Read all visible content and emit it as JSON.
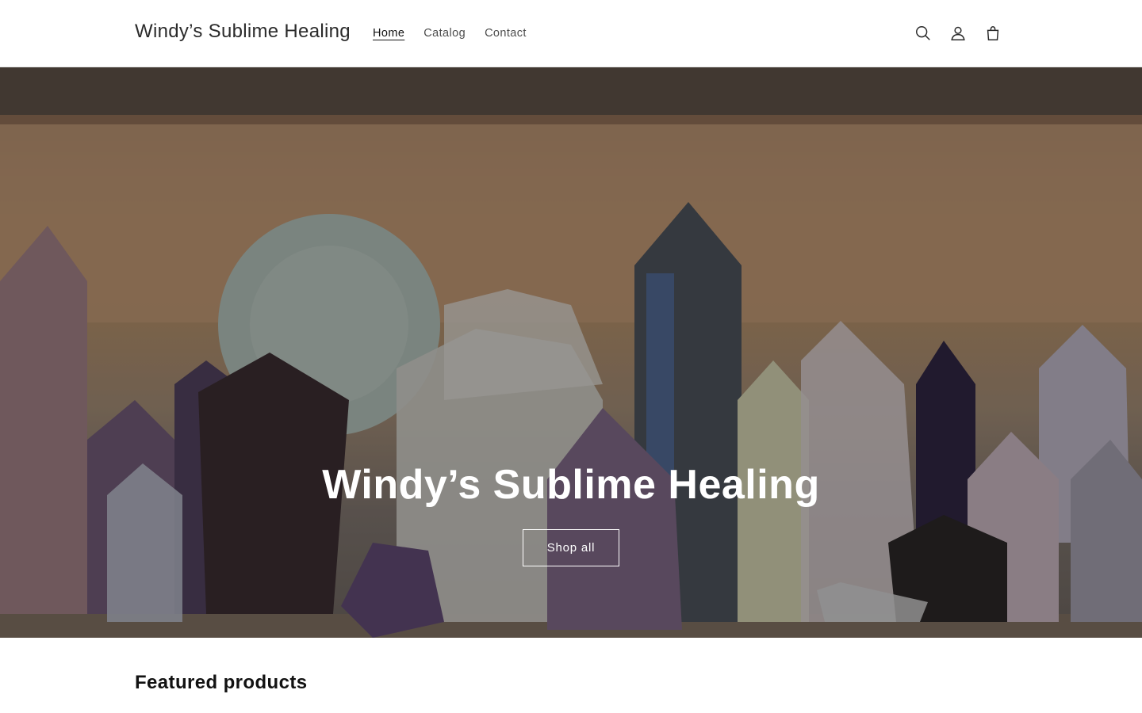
{
  "header": {
    "brand": "Windy’s Sublime Healing",
    "nav": [
      {
        "label": "Home",
        "active": true
      },
      {
        "label": "Catalog",
        "active": false
      },
      {
        "label": "Contact",
        "active": false
      }
    ],
    "icons": [
      "search-icon",
      "account-icon",
      "cart-icon"
    ]
  },
  "hero": {
    "title": "Windy’s Sublime Healing",
    "button_label": "Shop all"
  },
  "featured": {
    "title": "Featured products"
  },
  "colors": {
    "background": "#ffffff",
    "text": "#121212",
    "hero_overlay": "rgba(0,0,0,0.28)",
    "hero_text": "#ffffff"
  }
}
